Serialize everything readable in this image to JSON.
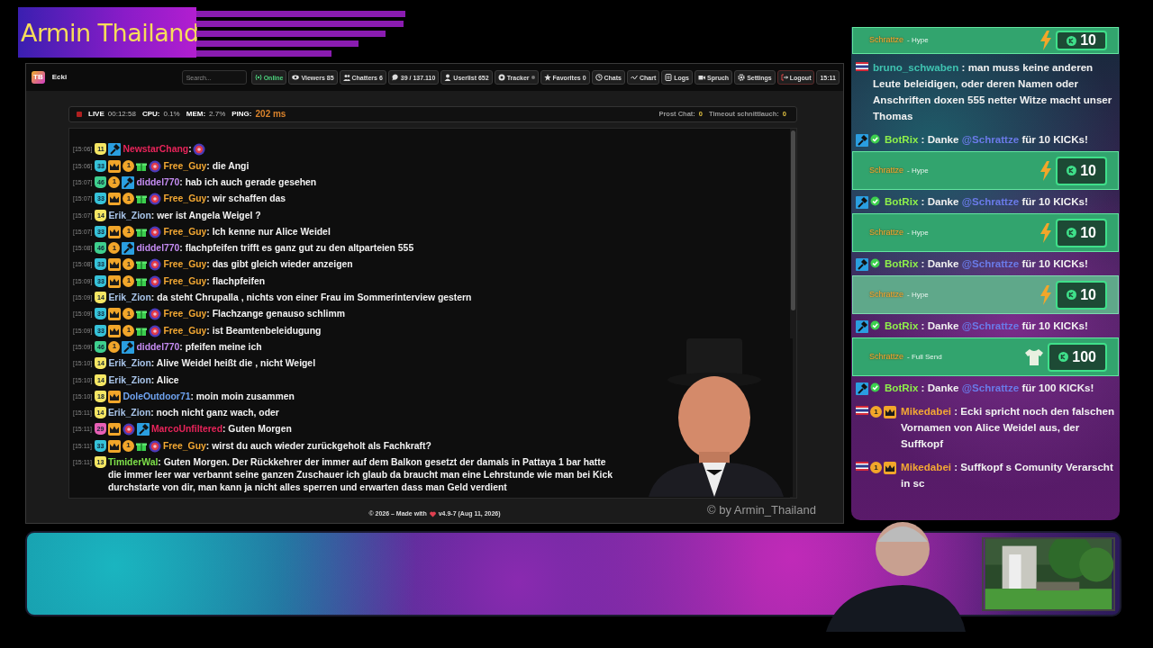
{
  "banner": {
    "title": "Armin Thailand"
  },
  "app": {
    "logo": "TB",
    "title": "Ecki",
    "search": {
      "placeholder": "Search..."
    },
    "nav_buttons": [
      {
        "kind": "online",
        "label": "Online"
      },
      {
        "kind": "eye",
        "label": "Viewers",
        "count": "85"
      },
      {
        "kind": "people",
        "label": "Chatters",
        "count": "6"
      },
      {
        "kind": "bubble",
        "label": "39 / 137.110"
      },
      {
        "kind": "person",
        "label": "Userlist",
        "count": "652"
      },
      {
        "kind": "tracker",
        "label": "Tracker"
      },
      {
        "kind": "star",
        "label": "Favorites",
        "count": "0"
      },
      {
        "kind": "clock",
        "label": "Chats"
      },
      {
        "kind": "chart",
        "label": "Chart"
      },
      {
        "kind": "doc",
        "label": "Logs"
      },
      {
        "kind": "video",
        "label": "Spruch"
      },
      {
        "kind": "gear",
        "label": "Settings"
      },
      {
        "kind": "logout",
        "label": "Logout"
      },
      {
        "kind": "time",
        "label": "15:11"
      }
    ],
    "stats": {
      "live": "LIVE",
      "uptime": "00:12:58",
      "items": [
        {
          "label": "CPU:",
          "value": "0.1%"
        },
        {
          "label": "MEM:",
          "value": "2.7%"
        },
        {
          "label": "PING:",
          "value": "202 ms",
          "color": "#d9822b"
        }
      ],
      "counters": [
        {
          "label": "Prost Chat:",
          "value": "0"
        },
        {
          "label": "Timeout schnittlauch:",
          "value": "0"
        }
      ]
    },
    "chat": [
      {
        "time": "[15:06]",
        "badges": [
          {
            "kind": "level",
            "text": "11",
            "color": "#f5e663"
          },
          {
            "kind": "hammer"
          }
        ],
        "user": "NewstarChang",
        "color": "#e8245a",
        "sep": ":",
        "emote": true
      },
      {
        "time": "[15:06]",
        "badges": [
          {
            "kind": "level",
            "text": "33",
            "color": "#36c2d9"
          },
          {
            "kind": "crown"
          },
          {
            "kind": "coin",
            "text": "1"
          },
          {
            "kind": "gift"
          },
          {
            "kind": "emblem"
          }
        ],
        "user": "Free_Guy",
        "color": "#f3a833",
        "sep": ":",
        "text": "die Angi"
      },
      {
        "time": "[15:07]",
        "badges": [
          {
            "kind": "level",
            "text": "46",
            "color": "#3ecf8e"
          },
          {
            "kind": "coin",
            "text": "1"
          },
          {
            "kind": "hammer"
          }
        ],
        "user": "diddel770",
        "color": "#c58cf2",
        "sep": ":",
        "text": "hab ich auch gerade gesehen"
      },
      {
        "time": "[15:07]",
        "badges": [
          {
            "kind": "level",
            "text": "33",
            "color": "#36c2d9"
          },
          {
            "kind": "crown"
          },
          {
            "kind": "coin",
            "text": "1"
          },
          {
            "kind": "gift"
          },
          {
            "kind": "emblem"
          }
        ],
        "user": "Free_Guy",
        "color": "#f3a833",
        "sep": ":",
        "text": "wir schaffen das"
      },
      {
        "time": "[15:07]",
        "badges": [
          {
            "kind": "level",
            "text": "14",
            "color": "#f5e663"
          }
        ],
        "user": "Erik_Zion",
        "color": "#a9c5ea",
        "sep": ":",
        "text": "wer ist Angela Weigel ?"
      },
      {
        "time": "[15:07]",
        "badges": [
          {
            "kind": "level",
            "text": "33",
            "color": "#36c2d9"
          },
          {
            "kind": "crown"
          },
          {
            "kind": "coin",
            "text": "1"
          },
          {
            "kind": "gift"
          },
          {
            "kind": "emblem"
          }
        ],
        "user": "Free_Guy",
        "color": "#f3a833",
        "sep": ":",
        "text": "Ich kenne nur Alice Weidel"
      },
      {
        "time": "[15:08]",
        "badges": [
          {
            "kind": "level",
            "text": "46",
            "color": "#3ecf8e"
          },
          {
            "kind": "coin",
            "text": "1"
          },
          {
            "kind": "hammer"
          }
        ],
        "user": "diddel770",
        "color": "#c58cf2",
        "sep": ":",
        "text": "flachpfeifen trifft es ganz gut zu den altparteien 555"
      },
      {
        "time": "[15:08]",
        "badges": [
          {
            "kind": "level",
            "text": "33",
            "color": "#36c2d9"
          },
          {
            "kind": "crown"
          },
          {
            "kind": "coin",
            "text": "1"
          },
          {
            "kind": "gift"
          },
          {
            "kind": "emblem"
          }
        ],
        "user": "Free_Guy",
        "color": "#f3a833",
        "sep": ":",
        "text": "das gibt gleich wieder anzeigen"
      },
      {
        "time": "[15:09]",
        "badges": [
          {
            "kind": "level",
            "text": "33",
            "color": "#36c2d9"
          },
          {
            "kind": "crown"
          },
          {
            "kind": "coin",
            "text": "1"
          },
          {
            "kind": "gift"
          },
          {
            "kind": "emblem"
          }
        ],
        "user": "Free_Guy",
        "color": "#f3a833",
        "sep": ":",
        "text": "flachpfeifen"
      },
      {
        "time": "[15:09]",
        "badges": [
          {
            "kind": "level",
            "text": "14",
            "color": "#f5e663"
          }
        ],
        "user": "Erik_Zion",
        "color": "#a9c5ea",
        "sep": ":",
        "text": "da steht Chrupalla , nichts von einer Frau im Sommerinterview gestern"
      },
      {
        "time": "[15:09]",
        "badges": [
          {
            "kind": "level",
            "text": "33",
            "color": "#36c2d9"
          },
          {
            "kind": "crown"
          },
          {
            "kind": "coin",
            "text": "1"
          },
          {
            "kind": "gift"
          },
          {
            "kind": "emblem"
          }
        ],
        "user": "Free_Guy",
        "color": "#f3a833",
        "sep": ":",
        "text": "Flachzange genauso schlimm"
      },
      {
        "time": "[15:09]",
        "badges": [
          {
            "kind": "level",
            "text": "33",
            "color": "#36c2d9"
          },
          {
            "kind": "crown"
          },
          {
            "kind": "coin",
            "text": "1"
          },
          {
            "kind": "gift"
          },
          {
            "kind": "emblem"
          }
        ],
        "user": "Free_Guy",
        "color": "#f3a833",
        "sep": ":",
        "text": "ist Beamtenbeleidugung"
      },
      {
        "time": "[15:09]",
        "badges": [
          {
            "kind": "level",
            "text": "46",
            "color": "#3ecf8e"
          },
          {
            "kind": "coin",
            "text": "1"
          },
          {
            "kind": "hammer"
          }
        ],
        "user": "diddel770",
        "color": "#c58cf2",
        "sep": ":",
        "text": "pfeifen meine ich"
      },
      {
        "time": "[15:10]",
        "badges": [
          {
            "kind": "level",
            "text": "14",
            "color": "#f5e663"
          }
        ],
        "user": "Erik_Zion",
        "color": "#a9c5ea",
        "sep": ":",
        "text": "Alive Weidel heißt die , nicht Weigel"
      },
      {
        "time": "[15:10]",
        "badges": [
          {
            "kind": "level",
            "text": "14",
            "color": "#f5e663"
          }
        ],
        "user": "Erik_Zion",
        "color": "#a9c5ea",
        "sep": ":",
        "text": "Alice"
      },
      {
        "time": "[15:10]",
        "badges": [
          {
            "kind": "level",
            "text": "18",
            "color": "#f5e663"
          },
          {
            "kind": "crown"
          }
        ],
        "user": "DoleOutdoor71",
        "color": "#6fa3f0",
        "sep": ":",
        "text": "moin moin zusammen"
      },
      {
        "time": "[15:11]",
        "badges": [
          {
            "kind": "level",
            "text": "14",
            "color": "#f5e663"
          }
        ],
        "user": "Erik_Zion",
        "color": "#a9c5ea",
        "sep": ":",
        "text": "noch nicht ganz wach, oder"
      },
      {
        "time": "[15:11]",
        "badges": [
          {
            "kind": "level",
            "text": "29",
            "color": "#e85fb5"
          },
          {
            "kind": "crown"
          },
          {
            "kind": "emblem"
          },
          {
            "kind": "hammer"
          }
        ],
        "user": "MarcoUnfiltered",
        "color": "#e8245a",
        "sep": ":",
        "text": "Guten Morgen"
      },
      {
        "time": "[15:11]",
        "badges": [
          {
            "kind": "level",
            "text": "33",
            "color": "#36c2d9"
          },
          {
            "kind": "crown"
          },
          {
            "kind": "coin",
            "text": "1"
          },
          {
            "kind": "gift"
          },
          {
            "kind": "emblem"
          }
        ],
        "user": "Free_Guy",
        "color": "#f3a833",
        "sep": ":",
        "text": "wirst du auch wieder zurückgeholt als Fachkraft?"
      },
      {
        "time": "[15:11]",
        "badges": [
          {
            "kind": "level",
            "text": "13",
            "color": "#f5e663"
          }
        ],
        "user": "TimiderWal",
        "color": "#7ee04a",
        "sep": ":",
        "text": "Guten Morgen. Der Rückkehrer der immer auf dem Balkon gesetzt der damals in Pattaya 1 bar hatte die immer leer war verbannt seine ganzen Zuschauer ich glaub da braucht man eine Lehrstunde wie man bei Kick durchstarte von dir, man kann ja nicht alles sperren und erwarten dass man Geld verdient"
      }
    ],
    "footer": {
      "text": "© 2026 – Made with",
      "version": "v4.9-7 (Aug 11, 2026)"
    }
  },
  "watermark_text": "© by Armin_Thailand",
  "side_chat": [
    {
      "kind": "tip",
      "user": "Schrattze",
      "label": "- Hype",
      "gift": {
        "kind": "bolt"
      },
      "amount": "10",
      "faded": false
    },
    {
      "kind": "message",
      "badges": [
        {
          "kind": "flag"
        }
      ],
      "user": "bruno_schwaben",
      "color": "#3fc3b0",
      "sep": ":",
      "text": "man muss keine anderen Leute beleidigen, oder deren Namen oder Anschriften doxen 555 netter Witze macht unser Thomas"
    },
    {
      "kind": "message",
      "badges": [
        {
          "kind": "hammer"
        },
        {
          "kind": "verified"
        }
      ],
      "user": "BotRix",
      "color": "#8ef04a",
      "sep": ":",
      "text": "Danke",
      "mention": "@Schrattze",
      "text_after": "für 10 KICKs!"
    },
    {
      "kind": "tip",
      "user": "Schrattze",
      "label": "- Hype",
      "gift": {
        "kind": "bolt"
      },
      "amount": "10",
      "faded": false
    },
    {
      "kind": "message",
      "badges": [
        {
          "kind": "hammer"
        },
        {
          "kind": "verified"
        }
      ],
      "user": "BotRix",
      "color": "#8ef04a",
      "sep": ":",
      "text": "Danke",
      "mention": "@Schrattze",
      "text_after": "für 10 KICKs!"
    },
    {
      "kind": "tip",
      "user": "Schrattze",
      "label": "- Hype",
      "gift": {
        "kind": "bolt"
      },
      "amount": "10",
      "faded": false
    },
    {
      "kind": "message",
      "badges": [
        {
          "kind": "hammer"
        },
        {
          "kind": "verified"
        }
      ],
      "user": "BotRix",
      "color": "#8ef04a",
      "sep": ":",
      "text": "Danke",
      "mention": "@Schrattze",
      "text_after": "für 10 KICKs!"
    },
    {
      "kind": "tip",
      "user": "Schrattze",
      "label": "- Hype",
      "gift": {
        "kind": "bolt"
      },
      "amount": "10",
      "faded": true
    },
    {
      "kind": "message",
      "badges": [
        {
          "kind": "hammer"
        },
        {
          "kind": "verified"
        }
      ],
      "user": "BotRix",
      "color": "#8ef04a",
      "sep": ":",
      "text": "Danke",
      "mention": "@Schrattze",
      "text_after": "für 10 KICKs!"
    },
    {
      "kind": "tip",
      "user": "Schrattze",
      "label": "- Full Send",
      "gift": {
        "kind": "shirt"
      },
      "amount": "100",
      "faded": false
    },
    {
      "kind": "message",
      "badges": [
        {
          "kind": "hammer"
        },
        {
          "kind": "verified"
        }
      ],
      "user": "BotRix",
      "color": "#8ef04a",
      "sep": ":",
      "text": "Danke",
      "mention": "@Schrattze",
      "text_after": "für 100 KICKs!"
    },
    {
      "kind": "message",
      "badges": [
        {
          "kind": "flag"
        },
        {
          "kind": "coin",
          "text": "1"
        },
        {
          "kind": "crown"
        }
      ],
      "user": "Mikedabei",
      "color": "#f3a833",
      "sep": ":",
      "text": "Ecki spricht noch den falschen Vornamen von Alice Weidel aus, der Suffkopf"
    },
    {
      "kind": "message",
      "badges": [
        {
          "kind": "flag"
        },
        {
          "kind": "coin",
          "text": "1"
        },
        {
          "kind": "crown"
        }
      ],
      "user": "Mikedabei",
      "color": "#f3a833",
      "sep": ":",
      "text": "Suffkopf s Comunity Verarscht in sc"
    }
  ]
}
